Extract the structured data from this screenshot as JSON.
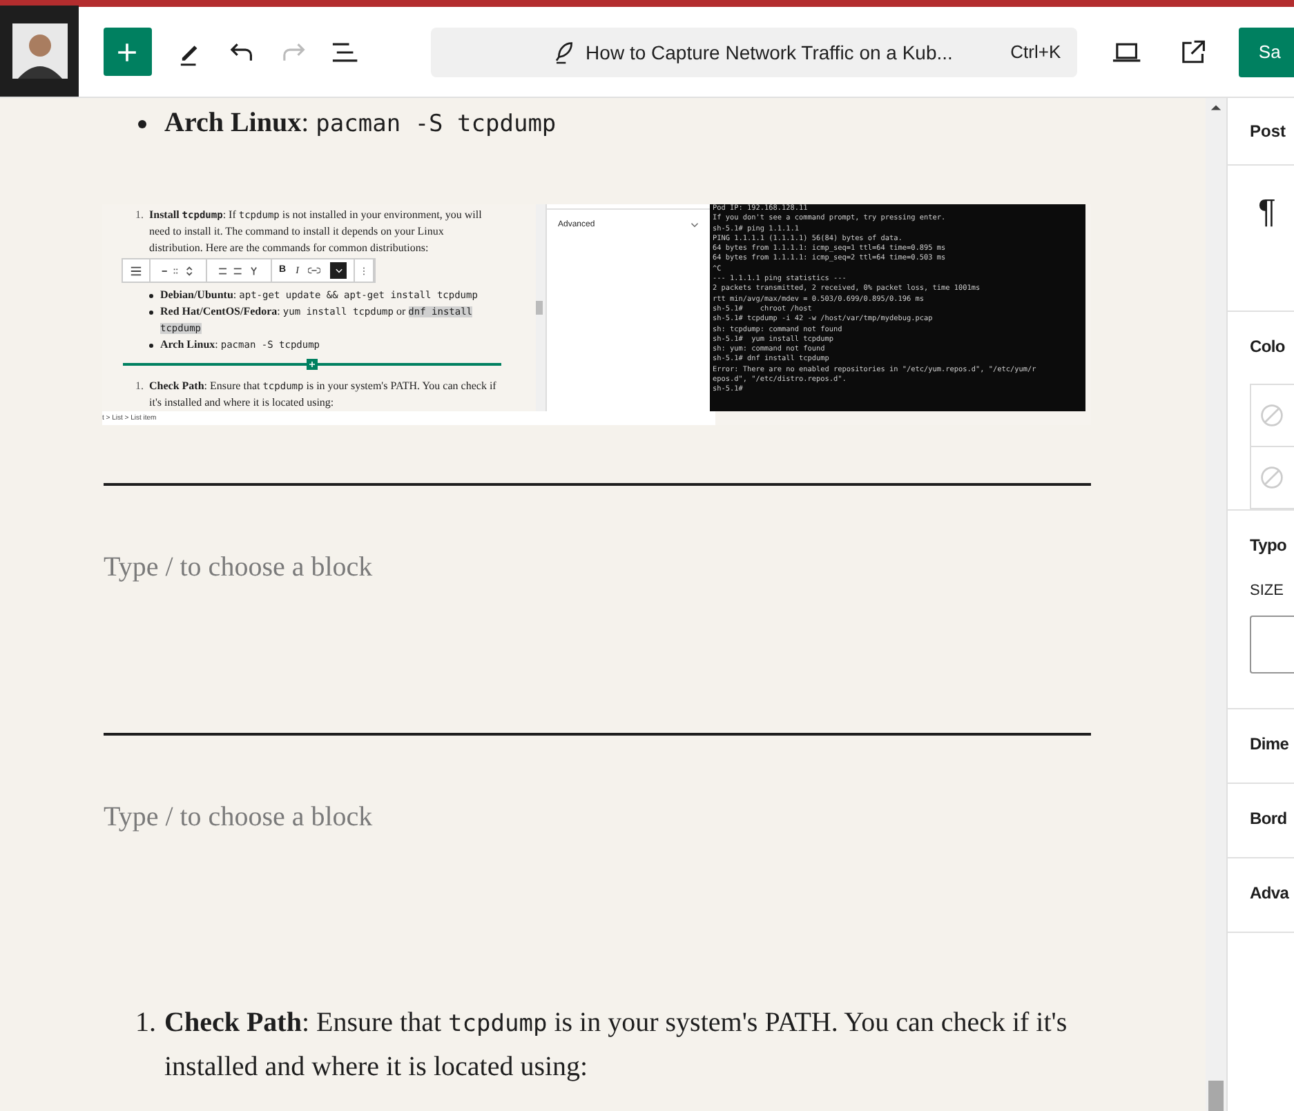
{
  "topbar": {
    "document_title": "How to Capture Network Traffic on a Kub...",
    "shortcut": "Ctrl+K",
    "save_button": "Sa"
  },
  "blocks": [
    {
      "kind": "bullet",
      "parts": [
        {
          "kind": "bold",
          "text": "Arch Linux"
        },
        {
          "kind": "text",
          "text": ": "
        },
        {
          "kind": "code",
          "text": "pacman -S tcpdump"
        }
      ]
    },
    {
      "kind": "image",
      "editor": {
        "items": [
          {
            "kind": "numbered",
            "number": "1.",
            "parts": [
              {
                "kind": "bold",
                "text": "Install "
              },
              {
                "kind": "boldcode",
                "text": "tcpdump"
              },
              {
                "kind": "text",
                "text": ": If "
              },
              {
                "kind": "code",
                "text": "tcpdump"
              },
              {
                "kind": "text",
                "text": " is not installed in your environment, you will need to install it. The command to install it depends on your Linux distribution. Here are the commands for common distributions:"
              }
            ]
          },
          {
            "kind": "bullet",
            "parts": [
              {
                "kind": "bold",
                "text": "Debian/Ubuntu"
              },
              {
                "kind": "text",
                "text": ": "
              },
              {
                "kind": "code",
                "text": "apt-get update && apt-get install tcpdump"
              }
            ]
          },
          {
            "kind": "bullet",
            "parts": [
              {
                "kind": "bold",
                "text": "Red Hat/CentOS/Fedora"
              },
              {
                "kind": "text",
                "text": ": "
              },
              {
                "kind": "code",
                "text": "yum install tcpdump"
              },
              {
                "kind": "text",
                "text": " or "
              },
              {
                "kind": "mark",
                "text": "dnf install tcpdump"
              }
            ]
          },
          {
            "kind": "bullet",
            "parts": [
              {
                "kind": "bold",
                "text": "Arch Linux"
              },
              {
                "kind": "text",
                "text": ": "
              },
              {
                "kind": "code",
                "text": "pacman -S tcpdump"
              }
            ]
          },
          {
            "kind": "inserter"
          },
          {
            "kind": "numbered",
            "number": "1.",
            "parts": [
              {
                "kind": "bold",
                "text": "Check Path"
              },
              {
                "kind": "text",
                "text": ": Ensure that "
              },
              {
                "kind": "code",
                "text": "tcpdump"
              },
              {
                "kind": "text",
                "text": " is in your system's PATH. You can check if it's installed and where it is located using:"
              }
            ]
          }
        ],
        "toolbar": {
          "bold": "B",
          "italic": "I"
        },
        "breadcrumb": "t > List > List item",
        "panel_section": "Advanced"
      },
      "terminal_lines": [
        "Pod IP: 192.168.128.11",
        "If you don't see a command prompt, try pressing enter.",
        "sh-5.1# ping 1.1.1.1",
        "PING 1.1.1.1 (1.1.1.1) 56(84) bytes of data.",
        "64 bytes from 1.1.1.1: icmp_seq=1 ttl=64 time=0.895 ms",
        "64 bytes from 1.1.1.1: icmp_seq=2 ttl=64 time=0.503 ms",
        "^C",
        "--- 1.1.1.1 ping statistics ---",
        "2 packets transmitted, 2 received, 0% packet loss, time 1001ms",
        "rtt min/avg/max/mdev = 0.503/0.699/0.895/0.196 ms",
        "sh-5.1#    chroot /host",
        "sh-5.1# tcpdump -i 42 -w /host/var/tmp/mydebug.pcap",
        "sh: tcpdump: command not found",
        "sh-5.1#  yum install tcpdump",
        "sh: yum: command not found",
        "sh-5.1# dnf install tcpdump",
        "Error: There are no enabled repositories in \"/etc/yum.repos.d\", \"/etc/yum/r",
        "epos.d\", \"/etc/distro.repos.d\".",
        "sh-5.1# "
      ]
    },
    {
      "kind": "separator"
    },
    {
      "kind": "placeholder",
      "text": "Type / to choose a block"
    },
    {
      "kind": "separator"
    },
    {
      "kind": "placeholder",
      "text": "Type / to choose a block"
    },
    {
      "kind": "numbered",
      "number": "1.",
      "parts": [
        {
          "kind": "bold",
          "text": "Check Path"
        },
        {
          "kind": "text",
          "text": ": Ensure that "
        },
        {
          "kind": "code",
          "text": "tcpdump"
        },
        {
          "kind": "text",
          "text": " is in your system's PATH. You can check if it's installed and where it is located using:"
        }
      ]
    }
  ],
  "sidebar": {
    "tab": "Post",
    "paragraph_icon": "¶",
    "sections": [
      {
        "kind": "color",
        "title": "Colo"
      },
      {
        "kind": "typography",
        "title": "Typo",
        "size_label": "SIZE"
      },
      {
        "kind": "plain",
        "title": "Dime"
      },
      {
        "kind": "plain",
        "title": "Bord"
      },
      {
        "kind": "plain",
        "title": "Adva"
      }
    ]
  }
}
